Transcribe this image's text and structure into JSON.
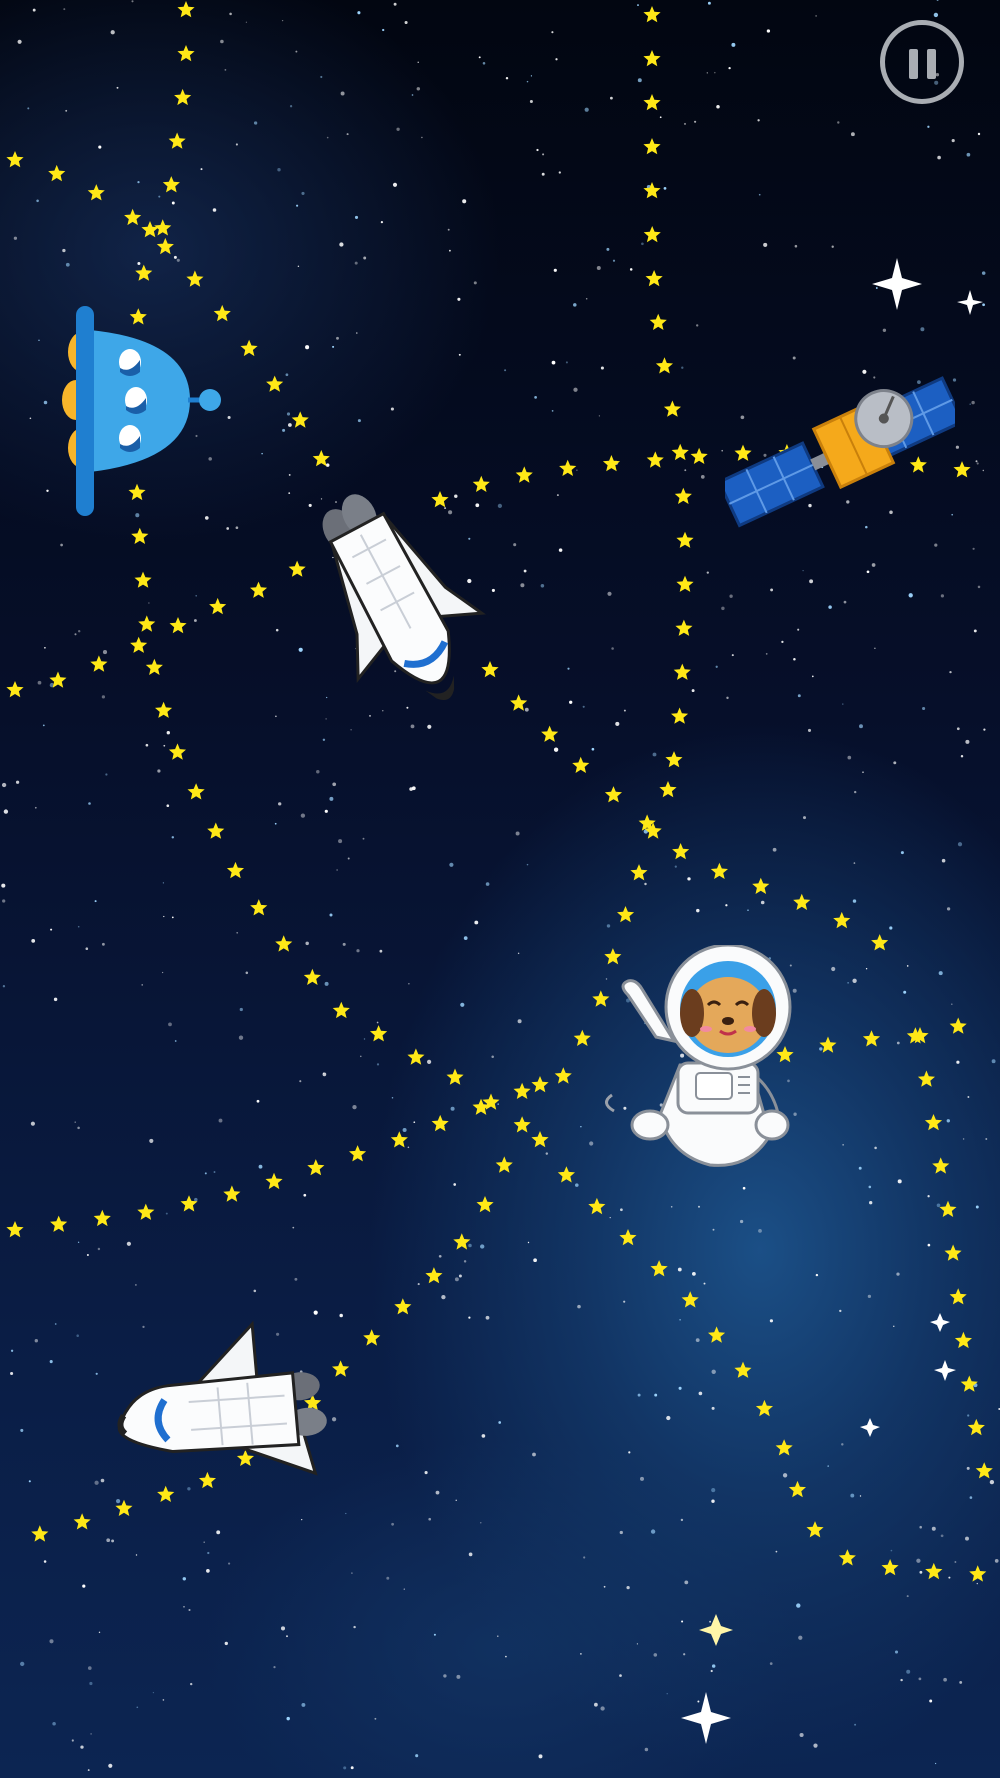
{
  "game": {
    "pause_button": {
      "icon": "pause-icon"
    },
    "sprites": [
      {
        "id": "ufo",
        "icon": "ufo-icon"
      },
      {
        "id": "shuttle-upper",
        "icon": "space-shuttle-icon"
      },
      {
        "id": "satellite",
        "icon": "satellite-icon"
      },
      {
        "id": "astronaut-dog",
        "icon": "astronaut-dog-icon"
      },
      {
        "id": "shuttle-lower",
        "icon": "space-shuttle-icon"
      }
    ],
    "colors": {
      "star_path": "#ffe817",
      "space_dark": "#020611",
      "space_blue": "#1b4f86",
      "pause_ring": "#a9adb3"
    }
  }
}
